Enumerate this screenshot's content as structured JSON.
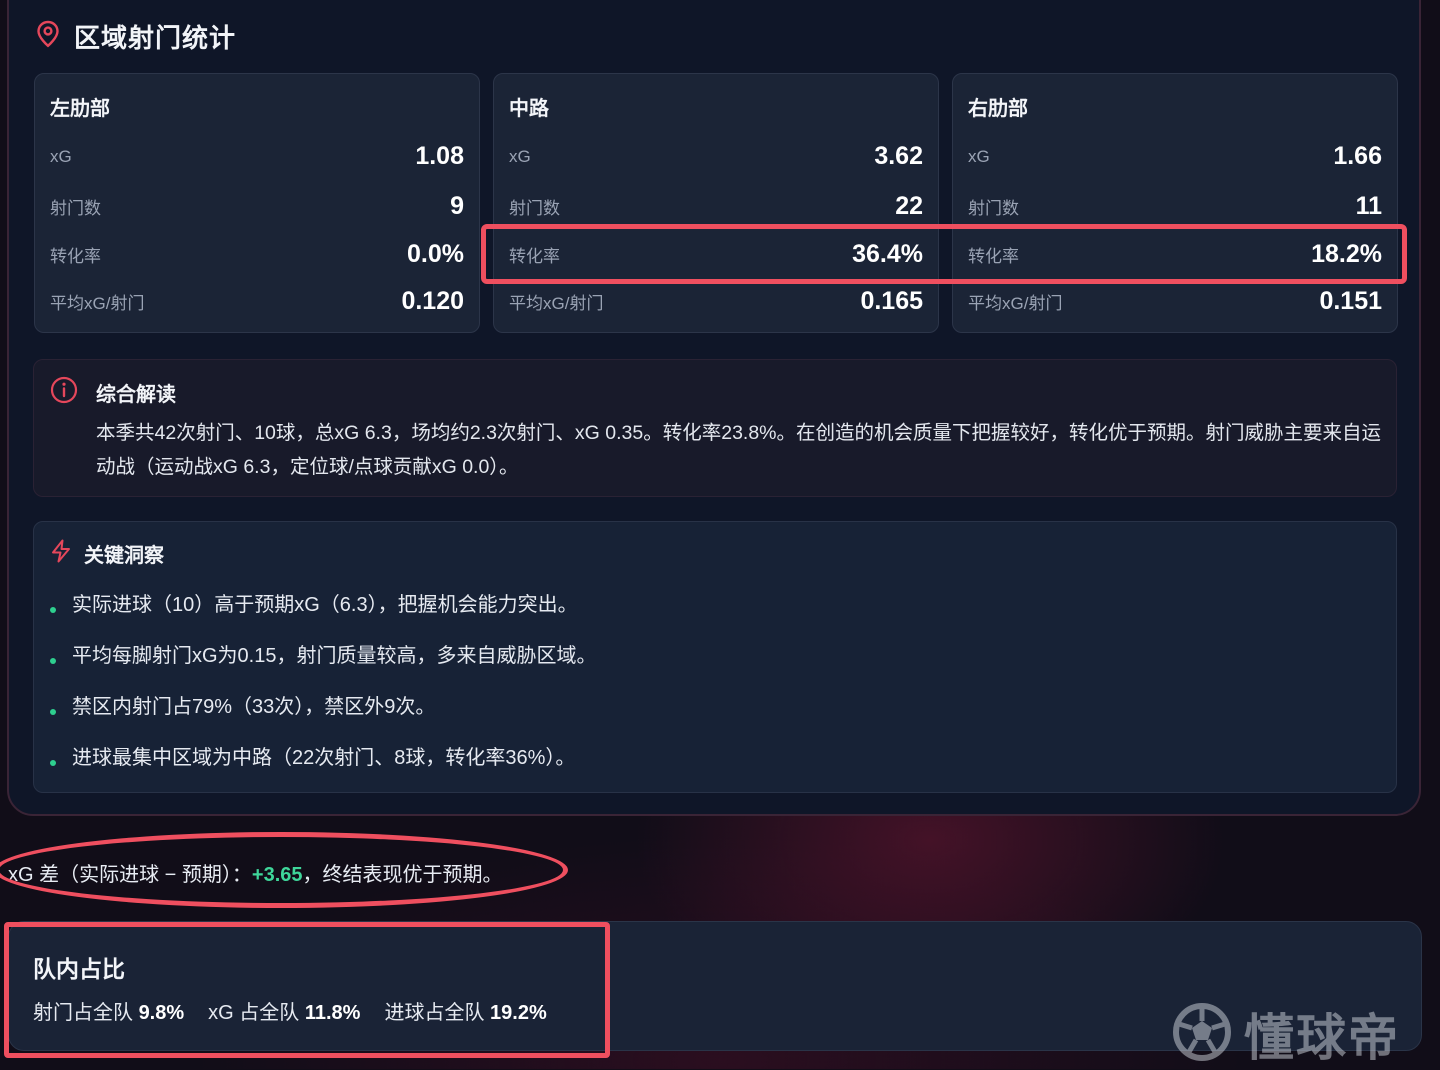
{
  "section": {
    "title": "区域射门统计",
    "icon": "map-pin-icon"
  },
  "zones": [
    {
      "name": "左肋部",
      "xg_label": "xG",
      "xg": "1.08",
      "shots_label": "射门数",
      "shots": "9",
      "conv_label": "转化率",
      "conv": "0.0%",
      "avg_label": "平均xG/射门",
      "avg": "0.120"
    },
    {
      "name": "中路",
      "xg_label": "xG",
      "xg": "3.62",
      "shots_label": "射门数",
      "shots": "22",
      "conv_label": "转化率",
      "conv": "36.4%",
      "avg_label": "平均xG/射门",
      "avg": "0.165"
    },
    {
      "name": "右肋部",
      "xg_label": "xG",
      "xg": "1.66",
      "shots_label": "射门数",
      "shots": "11",
      "conv_label": "转化率",
      "conv": "18.2%",
      "avg_label": "平均xG/射门",
      "avg": "0.151"
    }
  ],
  "summary": {
    "title": "综合解读",
    "icon": "info-circle-icon",
    "text": "本季共42次射门、10球，总xG 6.3，场均约2.3次射门、xG 0.35。转化率23.8%。在创造的机会质量下把握较好，转化优于预期。射门威胁主要来自运动战（运动战xG 6.3，定位球/点球贡献xG 0.0）。"
  },
  "insights": {
    "title": "关键洞察",
    "icon": "lightning-icon",
    "items": [
      "实际进球（10）高于预期xG（6.3），把握机会能力突出。",
      "平均每脚射门xG为0.15，射门质量较高，多来自威胁区域。",
      "禁区内射门占79%（33次），禁区外9次。",
      "进球最集中区域为中路（22次射门、8球，转化率36%）。"
    ]
  },
  "xg_diff": {
    "prefix": "xG 差（实际进球 − 预期）：",
    "value": "+3.65",
    "suffix": "，终结表现优于预期。"
  },
  "team_share": {
    "title": "队内占比",
    "shots_label": "射门占全队",
    "shots": "9.8%",
    "xg_label": "xG 占全队",
    "xg": "11.8%",
    "goals_label": "进球占全队",
    "goals": "19.2%"
  },
  "watermark": {
    "text": "懂球帝",
    "icon": "football-logo-icon"
  },
  "colors": {
    "accent_red": "#ef4f5f",
    "positive_green": "#3fd69a",
    "bullet_green": "#2ecf8f",
    "panel_bg": "#0f1628"
  }
}
